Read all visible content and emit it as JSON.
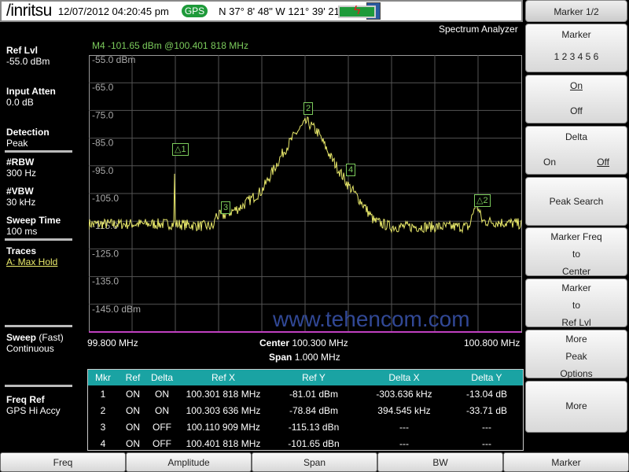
{
  "header": {
    "logo": "/inritsu",
    "datetime": "12/07/2012 04:20:45 pm",
    "gps": "GPS",
    "coords": "N 37° 8' 48\" W 121° 39' 21\"",
    "mode": "Spectrum Analyzer"
  },
  "marker_readout": "M4 -101.65 dBm @100.401 818 MHz",
  "left": {
    "ref_lvl_label": "Ref Lvl",
    "ref_lvl": "-55.0 dBm",
    "atten_label": "Input Atten",
    "atten": "0.0 dB",
    "det_label": "Detection",
    "det": "Peak",
    "rbw_label": "#RBW",
    "rbw": "300 Hz",
    "vbw_label": "#VBW",
    "vbw": "30 kHz",
    "sweep_time_label": "Sweep Time",
    "sweep_time": "100 ms",
    "traces_label": "Traces",
    "traces": "A: Max Hold",
    "sweep_label": "Sweep",
    "sweep_fast": "(Fast)",
    "sweep": "Continuous",
    "freqref_label": "Freq Ref",
    "freqref": "GPS Hi Accy"
  },
  "y_ticks": [
    "-55.0 dBm",
    "-65.0",
    "-75.0",
    "-85.0",
    "-95.0",
    "-105.0",
    "-115.0",
    "-125.0",
    "-135.0",
    "-145.0 dBm"
  ],
  "x_axis": {
    "start": "99.800 MHz",
    "center_label": "Center",
    "center": "100.300 MHz",
    "span_label": "Span",
    "span": "1.000 MHz",
    "stop": "100.800 MHz"
  },
  "chart_data": {
    "type": "line",
    "xlim": [
      99.8,
      100.8
    ],
    "ylim": [
      -155,
      -55
    ],
    "grid": true,
    "color": "#e8e86a",
    "trace": [
      [
        99.8,
        -116
      ],
      [
        99.997,
        -116
      ],
      [
        99.998,
        -96
      ],
      [
        100.0,
        -116
      ],
      [
        100.09,
        -117
      ],
      [
        100.092,
        -113
      ],
      [
        100.11,
        -113
      ],
      [
        100.15,
        -110
      ],
      [
        100.2,
        -104
      ],
      [
        100.25,
        -90
      ],
      [
        100.28,
        -83
      ],
      [
        100.304,
        -79
      ],
      [
        100.33,
        -83
      ],
      [
        100.36,
        -92
      ],
      [
        100.4,
        -102
      ],
      [
        100.43,
        -108
      ],
      [
        100.46,
        -115
      ],
      [
        100.5,
        -117
      ],
      [
        100.68,
        -117
      ],
      [
        100.695,
        -108
      ],
      [
        100.71,
        -115
      ],
      [
        100.8,
        -116
      ]
    ]
  },
  "markers": [
    {
      "label": "△1"
    },
    {
      "label": "2"
    },
    {
      "label": "3"
    },
    {
      "label": "4"
    },
    {
      "label": "△2"
    }
  ],
  "watermark": "www.tehencom.com",
  "table": {
    "headers": [
      "Mkr",
      "Ref",
      "Delta",
      "Ref X",
      "Ref Y",
      "Delta X",
      "Delta Y"
    ],
    "rows": [
      [
        "1",
        "ON",
        "ON",
        "100.301 818 MHz",
        "-81.01 dBm",
        "-303.636 kHz",
        "-13.04 dB"
      ],
      [
        "2",
        "ON",
        "ON",
        "100.303 636 MHz",
        "-78.84 dBm",
        "394.545 kHz",
        "-33.71 dB"
      ],
      [
        "3",
        "ON",
        "OFF",
        "100.110 909 MHz",
        "-115.13 dBn",
        "---",
        "---"
      ],
      [
        "4",
        "ON",
        "OFF",
        "100.401 818 MHz",
        "-101.65 dBn",
        "---",
        "---"
      ]
    ]
  },
  "softkeys": {
    "title": "Marker 1/2",
    "marker": "Marker",
    "marker_nums": "1 2 3 4 5 6",
    "on": "On",
    "off": "Off",
    "delta": "Delta",
    "delta_on": "On",
    "delta_off": "Off",
    "peak": "Peak Search",
    "mfc": [
      "Marker Freq",
      "to",
      "Center"
    ],
    "mrl": [
      "Marker",
      "to",
      "Ref Lvl"
    ],
    "mpo": [
      "More",
      "Peak",
      "Options"
    ],
    "more": "More"
  },
  "tabs": [
    "Freq",
    "Amplitude",
    "Span",
    "BW",
    "Marker"
  ]
}
